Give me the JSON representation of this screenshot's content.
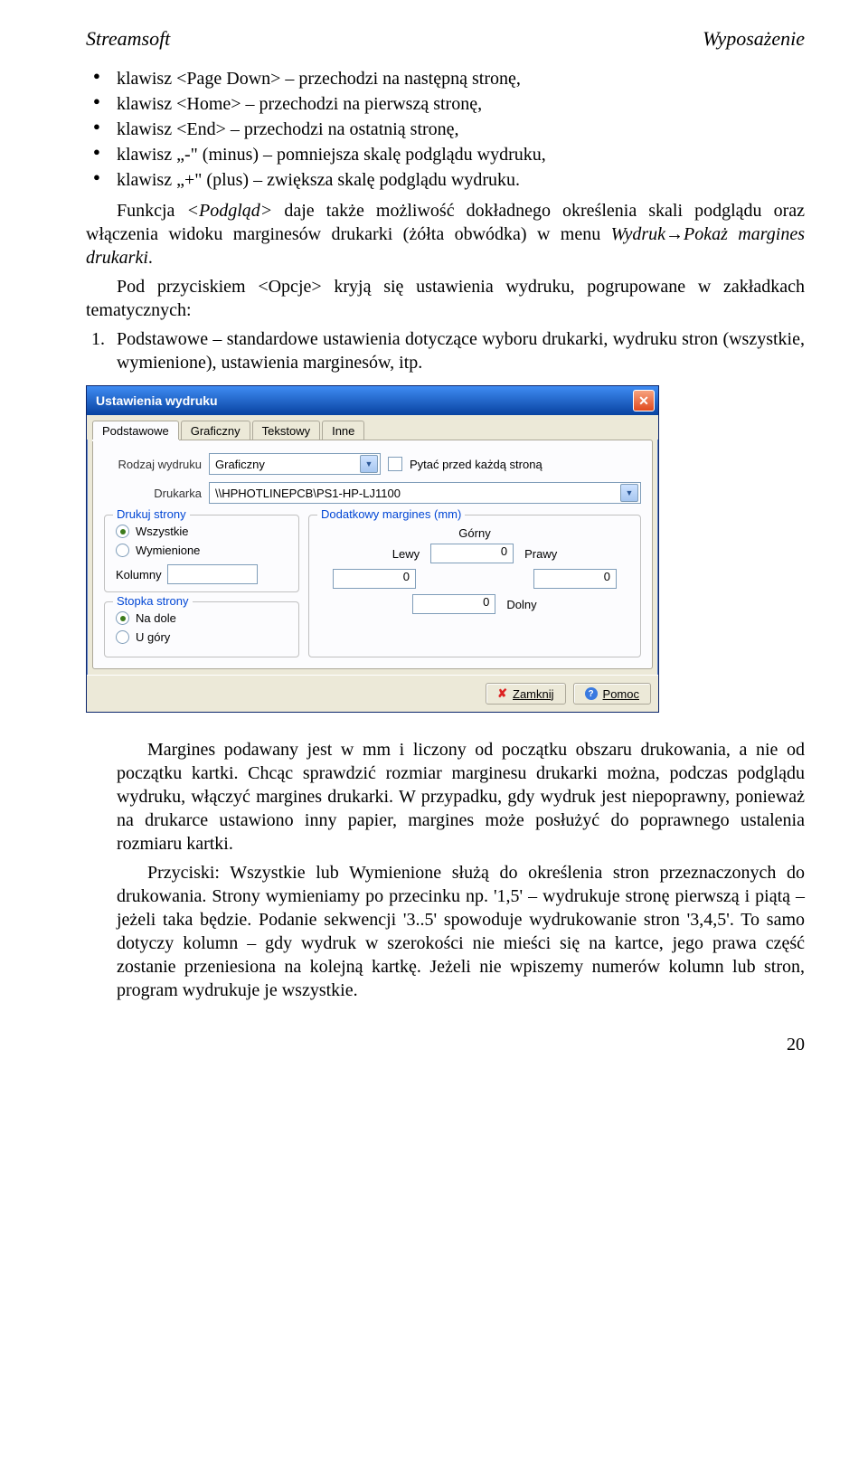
{
  "header": {
    "left": "Streamsoft",
    "right": "Wyposażenie"
  },
  "bullets": [
    "klawisz <Page Down> – przechodzi na następną stronę,",
    "klawisz <Home> – przechodzi na pierwszą stronę,",
    "klawisz <End> – przechodzi na ostatnią stronę,",
    "klawisz „-\" (minus) – pomniejsza skalę podglądu wydruku,",
    "klawisz „+\" (plus) – zwiększa skalę podglądu wydruku."
  ],
  "para1": "Funkcja <Podgląd> daje także możliwość dokładnego określenia skali podglądu oraz włączenia widoku marginesów drukarki (żółta obwódka) w menu Wydruk→Pokaż margines drukarki.",
  "para2": "Pod przyciskiem <Opcje> kryją się ustawienia wydruku, pogrupowane w zakładkach tematycznych:",
  "numbered": {
    "marker": "1.",
    "text": "Podstawowe – standardowe ustawienia dotyczące wyboru drukarki, wydruku stron (wszystkie, wymienione), ustawienia marginesów, itp."
  },
  "dialog": {
    "title": "Ustawienia wydruku",
    "tabs": [
      "Podstawowe",
      "Graficzny",
      "Tekstowy",
      "Inne"
    ],
    "active_tab": 0,
    "rodzaj_label": "Rodzaj wydruku",
    "rodzaj_value": "Graficzny",
    "pytac": "Pytać przed każdą stroną",
    "drukarka_label": "Drukarka",
    "drukarka_value": "\\\\HPHOTLINEPCB\\PS1-HP-LJ1100",
    "drukuj_strony": {
      "legend": "Drukuj strony",
      "wszystkie": "Wszystkie",
      "wymienione": "Wymienione",
      "kolumny": "Kolumny"
    },
    "stopka": {
      "legend": "Stopka strony",
      "na_dole": "Na dole",
      "u_gory": "U góry"
    },
    "margines": {
      "legend": "Dodatkowy margines (mm)",
      "gorny": "Górny",
      "lewy": "Lewy",
      "prawy": "Prawy",
      "dolny": "Dolny",
      "v_top": "0",
      "v_left": "0",
      "v_right": "0",
      "v_bottom": "0"
    },
    "btn_close": "Zamknij",
    "btn_help": "Pomoc"
  },
  "para3": "Margines podawany jest w mm i liczony od początku obszaru drukowania, a nie od początku kartki. Chcąc sprawdzić rozmiar marginesu drukarki można, podczas podglądu wydruku, włączyć margines drukarki. W przypadku, gdy wydruk jest niepoprawny, ponieważ na drukarce ustawiono inny papier, margines może posłużyć do poprawnego ustalenia rozmiaru kartki.",
  "para4": "Przyciski: Wszystkie lub Wymienione służą do określenia stron przeznaczonych do drukowania. Strony wymieniamy po przecinku np. '1,5' – wydrukuje stronę pierwszą i piątą – jeżeli taka będzie. Podanie sekwencji '3..5' spowoduje wydrukowanie stron '3,4,5'. To samo dotyczy kolumn – gdy wydruk w szerokości nie mieści się na kartce, jego prawa część zostanie przeniesiona na kolejną kartkę. Jeżeli nie wpiszemy numerów kolumn lub stron, program wydrukuje je wszystkie.",
  "page_number": "20"
}
